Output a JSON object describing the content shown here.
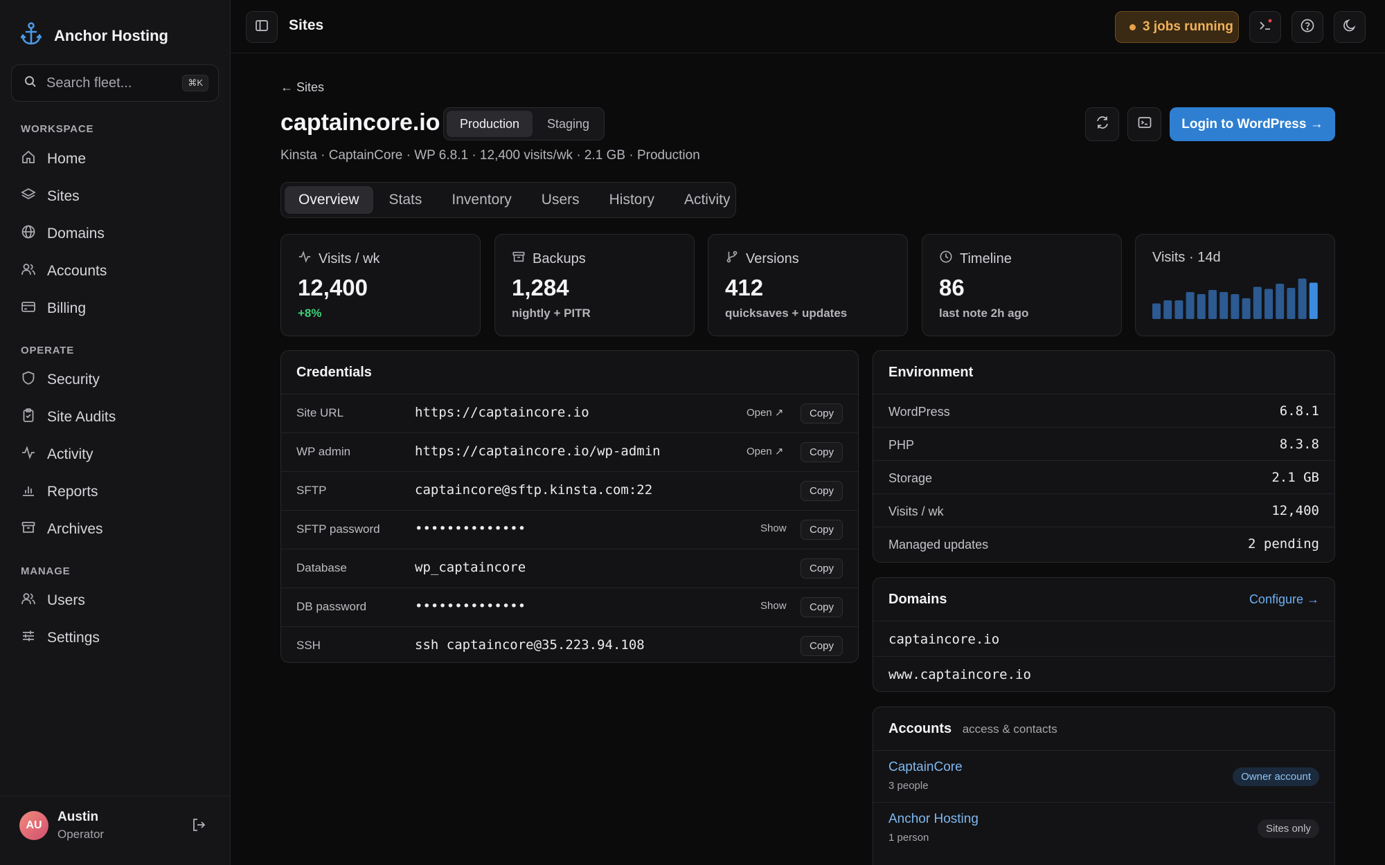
{
  "brand": {
    "name": "Anchor Hosting"
  },
  "search": {
    "placeholder": "Search fleet...",
    "shortcut": "⌘K"
  },
  "sidebar": {
    "sections": [
      {
        "label": "WORKSPACE"
      },
      {
        "label": "OPERATE"
      },
      {
        "label": "MANAGE"
      }
    ],
    "items": [
      {
        "label": "Home",
        "icon": "home-icon"
      },
      {
        "label": "Sites",
        "icon": "layers-icon"
      },
      {
        "label": "Domains",
        "icon": "globe-icon"
      },
      {
        "label": "Accounts",
        "icon": "users-icon"
      },
      {
        "label": "Billing",
        "icon": "card-icon"
      },
      {
        "label": "Security",
        "icon": "shield-icon"
      },
      {
        "label": "Site Audits",
        "icon": "clipboard-icon"
      },
      {
        "label": "Activity",
        "icon": "pulse-icon"
      },
      {
        "label": "Reports",
        "icon": "bar-chart-icon"
      },
      {
        "label": "Archives",
        "icon": "archive-icon"
      },
      {
        "label": "Users",
        "icon": "users-icon"
      },
      {
        "label": "Settings",
        "icon": "sliders-icon"
      }
    ],
    "user": {
      "initials": "AU",
      "name": "Austin",
      "role": "Operator"
    }
  },
  "topbar": {
    "title": "Sites",
    "jobs": "3 jobs running"
  },
  "page": {
    "back": "← Sites",
    "site_title": "captaincore.io",
    "env": {
      "active": "Production",
      "other": "Staging"
    },
    "subline": "Kinsta · CaptainCore · WP 6.8.1 · 12,400 visits/wk · 2.1 GB · Production",
    "login_button": "Login to WordPress →",
    "tabs": [
      "Overview",
      "Stats",
      "Inventory",
      "Users",
      "History",
      "Activity"
    ]
  },
  "stats": [
    {
      "label": "Visits / wk",
      "value": "12,400",
      "sub": "+8%",
      "icon": "pulse-icon"
    },
    {
      "label": "Backups",
      "value": "1,284",
      "sub": "nightly + PITR",
      "icon": "archive-icon"
    },
    {
      "label": "Versions",
      "value": "412",
      "sub": "quicksaves + updates",
      "icon": "git-branch-icon"
    },
    {
      "label": "Timeline",
      "value": "86",
      "sub": "last note 2h ago",
      "icon": "clock-icon"
    },
    {
      "label": "Visits · 14d"
    }
  ],
  "chart_data": {
    "type": "bar",
    "values": [
      30,
      36,
      36,
      52,
      48,
      56,
      52,
      48,
      40,
      62,
      58,
      68,
      60,
      78,
      70
    ],
    "colors": {
      "normal": "#2c5a91",
      "last": "#3b8be0"
    }
  },
  "credentials": {
    "title": "Credentials",
    "rows": [
      {
        "label": "Site URL",
        "value": "https://captaincore.io",
        "action": "Open ↗",
        "copy": "Copy"
      },
      {
        "label": "WP admin",
        "value": "https://captaincore.io/wp-admin",
        "action": "Open ↗",
        "copy": "Copy"
      },
      {
        "label": "SFTP",
        "value": "captaincore@sftp.kinsta.com:22",
        "action": "",
        "copy": "Copy"
      },
      {
        "label": "SFTP password",
        "value": "••••••••••••••",
        "action": "Show",
        "copy": "Copy"
      },
      {
        "label": "Database",
        "value": "wp_captaincore",
        "action": "",
        "copy": "Copy"
      },
      {
        "label": "DB password",
        "value": "••••••••••••••",
        "action": "Show",
        "copy": "Copy"
      },
      {
        "label": "SSH",
        "value": "ssh captaincore@35.223.94.108",
        "action": "",
        "copy": "Copy"
      }
    ]
  },
  "environment": {
    "title": "Environment",
    "rows": [
      {
        "key": "WordPress",
        "value": "6.8.1"
      },
      {
        "key": "PHP",
        "value": "8.3.8"
      },
      {
        "key": "Storage",
        "value": "2.1 GB"
      },
      {
        "key": "Visits / wk",
        "value": "12,400"
      },
      {
        "key": "Managed updates",
        "value": "2 pending"
      }
    ]
  },
  "domains": {
    "title": "Domains",
    "configure": "Configure →",
    "list": [
      "captaincore.io",
      "www.captaincore.io"
    ]
  },
  "accounts": {
    "title": "Accounts",
    "subtitle": "access & contacts",
    "list": [
      {
        "name": "CaptainCore",
        "people": "3 people",
        "badge": "Owner account"
      },
      {
        "name": "Anchor Hosting",
        "people": "1 person",
        "badge": "Sites only"
      }
    ]
  }
}
